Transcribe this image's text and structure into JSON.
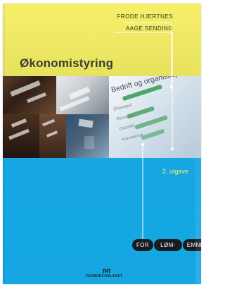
{
  "book": {
    "authors": [
      "FRODE HJERTNES",
      "AAGE SENDING"
    ],
    "title": "Økonomistyring",
    "edition": "2. utgave",
    "badge": [
      "FOR",
      "LØM-",
      "EMNET"
    ],
    "publisher": "FAGBOKFORLAGET"
  },
  "inset": {
    "heading": "Bedrift og organisasjon",
    "notes": [
      "Eksempel",
      "Ressurser",
      "Oversikt",
      "Kommentar"
    ]
  },
  "colors": {
    "yellow": "#f1ec67",
    "blue": "#14a7e2",
    "dark": "#161b20",
    "edition": "#eff15b"
  }
}
